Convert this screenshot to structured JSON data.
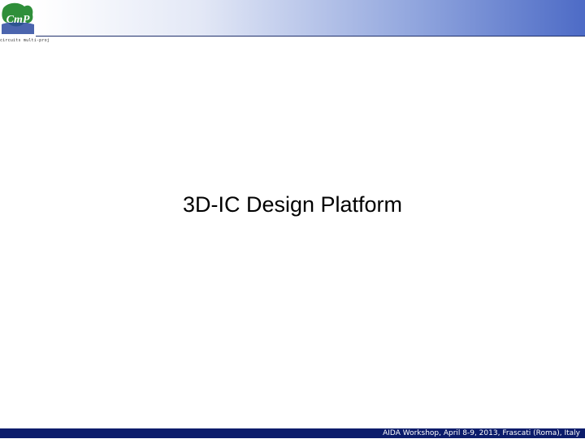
{
  "header": {
    "logo_icon": "cmp-logo-icon",
    "logo_text": "CmP",
    "logo_caption": "circuits multi-projets"
  },
  "slide": {
    "title": "3D-IC Design Platform"
  },
  "footer": {
    "text": "AIDA Workshop, April 8-9, 2013, Frascati (Roma), Italy"
  },
  "colors": {
    "header_gradient_start": "#ffffff",
    "header_gradient_end": "#4d6bc6",
    "footer_bar": "#0b1c6b",
    "footer_text": "#ffffff",
    "title_text": "#000000",
    "logo_green": "#2f8f3a",
    "logo_blue": "#2b4aa0"
  }
}
